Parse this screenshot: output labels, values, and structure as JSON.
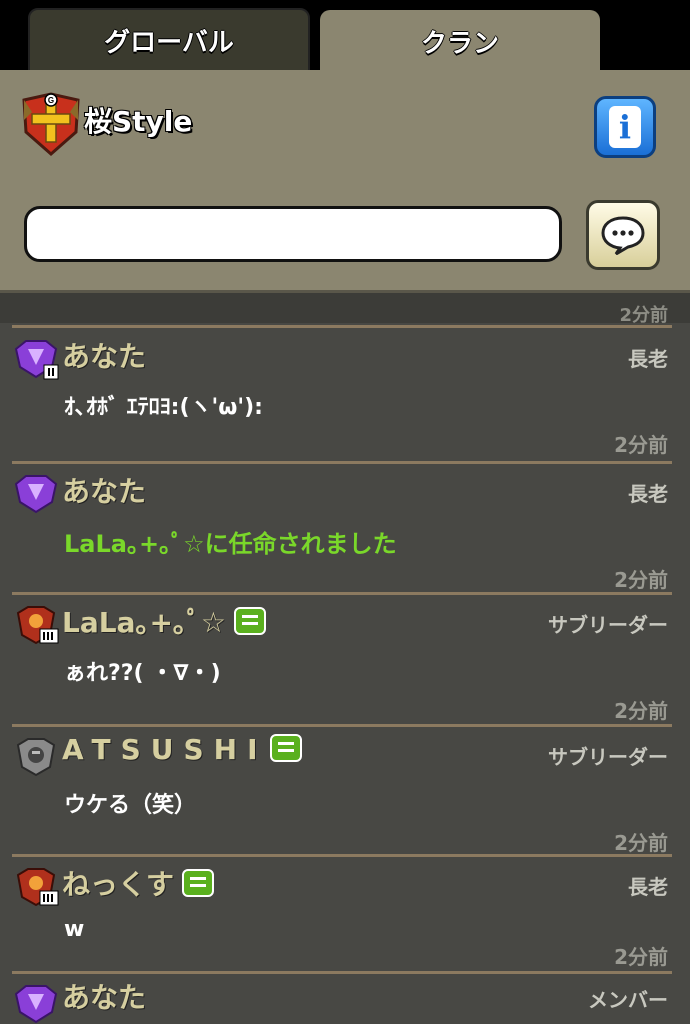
{
  "tabs": [
    {
      "label": "グローバル",
      "active": false
    },
    {
      "label": "クラン",
      "active": true
    }
  ],
  "clan": {
    "name": "桜Style",
    "badge_letter": "G",
    "info_icon": "info-icon"
  },
  "chat_input": {
    "value": "",
    "placeholder": ""
  },
  "partial_time": "2分前",
  "messages": [
    {
      "name": "あなた",
      "role": "長老",
      "text": "ｵ､ｵﾎﾞ ｴﾃﾛﾖ:(ヽ'ω'):",
      "time": "2分前",
      "rank_icon": "purple-league-icon",
      "system": false,
      "chat_tag": false
    },
    {
      "name": "あなた",
      "role": "長老",
      "text": "LaLa｡+｡ﾟ☆に任命されました",
      "time": "2分前",
      "rank_icon": "purple-league-icon",
      "system": true,
      "chat_tag": false
    },
    {
      "name": "LaLa｡+｡ﾟ☆",
      "role": "サブリーダー",
      "text": "ぁれ??( ・∇・)",
      "time": "2分前",
      "rank_icon": "red-league-icon",
      "system": false,
      "chat_tag": true
    },
    {
      "name": "ATSUSHI",
      "role": "サブリーダー",
      "text": "ウケる（笑）",
      "time": "2分前",
      "rank_icon": "silver-league-icon",
      "system": false,
      "chat_tag": true
    },
    {
      "name": "ねっくす",
      "role": "長老",
      "text": "w",
      "time": "2分前",
      "rank_icon": "red-league-icon",
      "system": false,
      "chat_tag": true
    },
    {
      "name": "あなた",
      "role": "メンバー",
      "text": "",
      "time": "",
      "rank_icon": "purple-league-icon",
      "system": false,
      "chat_tag": false
    }
  ],
  "colors": {
    "panel": "#8b8670",
    "chat_bg": "#484844",
    "name": "#d6cfa0",
    "system_text": "#7ad82a",
    "separator": "#8c7a60"
  }
}
